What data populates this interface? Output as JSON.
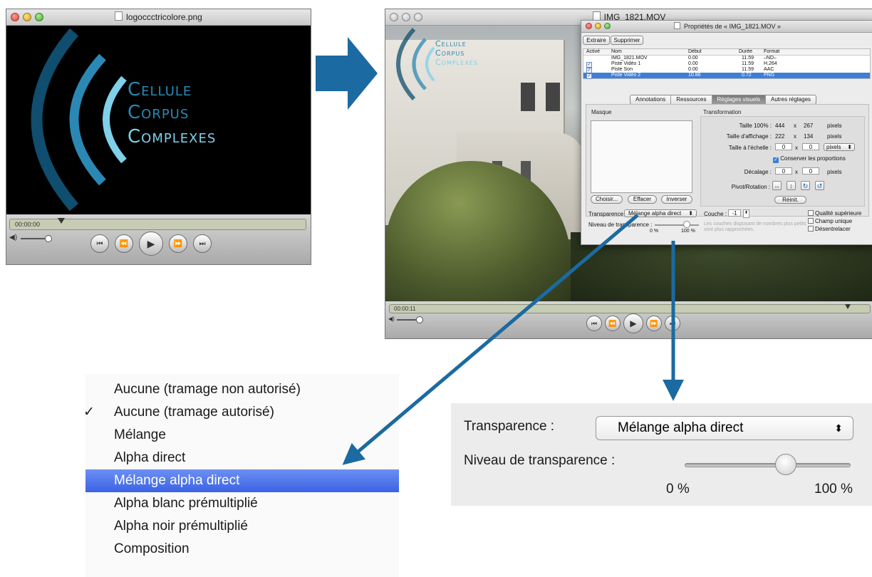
{
  "window_logo": {
    "title": "logoccctricolore.png",
    "time": "00:00:00",
    "logo_line1": "Cellule",
    "logo_line2": "Corpus",
    "logo_line3": "Complexes"
  },
  "window_movie": {
    "title": "IMG_1821.MOV",
    "time": "00:00:11",
    "logo_line1": "Cellule",
    "logo_line2": "Corpus",
    "logo_line3": "Complexes"
  },
  "properties": {
    "title": "Propriétés de « IMG_1821.MOV »",
    "extract_label": "Extraire",
    "delete_label": "Supprimer",
    "columns": {
      "active": "Activé",
      "name": "Nom",
      "start": "Début",
      "duration": "Durée",
      "format": "Format"
    },
    "tracks": [
      {
        "name": "IMG_1821.MOV",
        "start": "0.00",
        "duration": "11.59",
        "format": "–ND–",
        "checked": false
      },
      {
        "name": "Piste Vidéo 1",
        "start": "0.00",
        "duration": "11.59",
        "format": "H.264",
        "checked": true
      },
      {
        "name": "Piste Son",
        "start": "0.00",
        "duration": "11.59",
        "format": "AAC",
        "checked": true
      },
      {
        "name": "Piste Vidéo 2",
        "start": "10.86",
        "duration": "0.72",
        "format": "PNG",
        "checked": true
      }
    ],
    "tabs": [
      "Annotations",
      "Ressources",
      "Réglages visuels",
      "Autres réglages"
    ],
    "active_tab": "Réglages visuels",
    "mask_label": "Masque",
    "choose_label": "Choisir...",
    "clear_label": "Effacer",
    "invert_label": "Inverser",
    "transformation_label": "Transformation",
    "size100_label": "Taille 100% :",
    "size100_w": "444",
    "size100_h": "267",
    "display_label": "Taille d'affichage :",
    "display_w": "222",
    "display_h": "134",
    "scale_label": "Taille à l'échelle :",
    "scale_w": "0",
    "scale_h": "0",
    "pixels": "pixels",
    "times": "x",
    "keep_ratio_label": "Conserver les proportions",
    "offset_label": "Décalage :",
    "offset_x": "0",
    "offset_y": "0",
    "pivot_label": "Pivot/Rotation :",
    "reset_label": "Réinit.",
    "transparency_label": "Transparence :",
    "transparency_value": "Mélange alpha direct",
    "level_label": "Niveau de transparence :",
    "level_min": "0 %",
    "level_max": "100 %",
    "level_value_percent": 65,
    "layer_label": "Couche :",
    "layer_value": "-1",
    "layer_hint": "Les couches disposant de nombres plus petits sont plus rapprochées.",
    "quality_label": "Qualité supérieure",
    "single_field_label": "Champ unique",
    "deinterlace_label": "Désentrelacer"
  },
  "menu": {
    "items": [
      "Aucune (tramage non autorisé)",
      "Aucune (tramage autorisé)",
      "Mélange",
      "Alpha direct",
      "Mélange alpha direct",
      "Alpha blanc prémultiplié",
      "Alpha noir prémultiplié",
      "Composition"
    ],
    "checked": "Aucune (tramage autorisé)",
    "highlighted": "Mélange alpha direct",
    "checkmark": "✓"
  },
  "zoom": {
    "transparency_label": "Transparence :",
    "transparency_value": "Mélange alpha direct",
    "level_label": "Niveau de transparence :",
    "level_min": "0 %",
    "level_max": "100 %",
    "level_value_percent": 65
  },
  "colors": {
    "arrow": "#1b6aa1",
    "logo_dark": "#0f4e6e",
    "logo_mid": "#2b88b4",
    "logo_light": "#7fd0e8",
    "highlight": "#3a63e4"
  }
}
